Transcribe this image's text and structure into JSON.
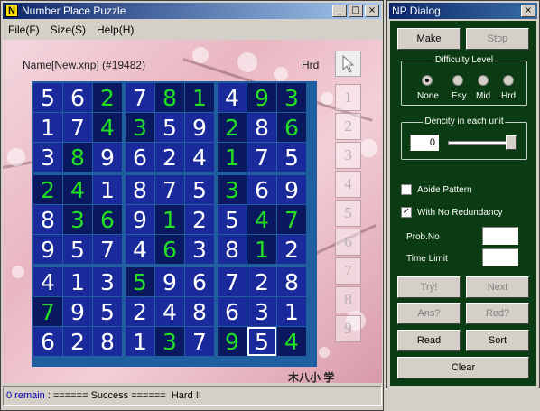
{
  "main_window": {
    "title": "Number Place Puzzle",
    "app_icon_letter": "N",
    "controls": {
      "min": "_",
      "max": "□",
      "close": "×"
    },
    "menu": [
      "File(F)",
      "Size(S)",
      "Help(H)"
    ],
    "puzzle_name": "Name[New.xnp] (#19482)",
    "difficulty": "Hrd",
    "credit": "木八小 学",
    "status": {
      "remain": "0 remain",
      "message": " : ====== Success ======  Hard !!"
    }
  },
  "grid": {
    "rows": [
      [
        "5",
        "6",
        "2",
        "7",
        "8",
        "1",
        "4",
        "9",
        "3"
      ],
      [
        "1",
        "7",
        "4",
        "3",
        "5",
        "9",
        "2",
        "8",
        "6"
      ],
      [
        "3",
        "8",
        "9",
        "6",
        "2",
        "4",
        "1",
        "7",
        "5"
      ],
      [
        "2",
        "4",
        "1",
        "8",
        "7",
        "5",
        "3",
        "6",
        "9"
      ],
      [
        "8",
        "3",
        "6",
        "9",
        "1",
        "2",
        "5",
        "4",
        "7"
      ],
      [
        "9",
        "5",
        "7",
        "4",
        "6",
        "3",
        "8",
        "1",
        "2"
      ],
      [
        "4",
        "1",
        "3",
        "5",
        "9",
        "6",
        "7",
        "2",
        "8"
      ],
      [
        "7",
        "9",
        "5",
        "2",
        "4",
        "8",
        "6",
        "3",
        "1"
      ],
      [
        "6",
        "2",
        "8",
        "1",
        "3",
        "7",
        "9",
        "5",
        "4"
      ]
    ],
    "solved_mask": [
      [
        0,
        0,
        1,
        0,
        1,
        1,
        0,
        1,
        1
      ],
      [
        0,
        0,
        1,
        1,
        0,
        0,
        1,
        0,
        1
      ],
      [
        0,
        1,
        0,
        0,
        0,
        0,
        1,
        0,
        0
      ],
      [
        1,
        1,
        0,
        0,
        0,
        0,
        1,
        0,
        0
      ],
      [
        0,
        1,
        1,
        0,
        1,
        0,
        0,
        1,
        1
      ],
      [
        0,
        0,
        0,
        0,
        1,
        0,
        0,
        1,
        0
      ],
      [
        0,
        0,
        0,
        1,
        0,
        0,
        0,
        0,
        0
      ],
      [
        1,
        0,
        0,
        0,
        0,
        0,
        0,
        0,
        0
      ],
      [
        0,
        0,
        0,
        0,
        1,
        0,
        1,
        0,
        1
      ]
    ],
    "selected": [
      8,
      7
    ],
    "colors": {
      "given_bg": "#1a2a9a",
      "solved_bg": "#0a1860",
      "solved_text": "#22e022",
      "given_text": "#ffffff",
      "border": "#1f5fa0"
    }
  },
  "number_buttons": [
    "1",
    "2",
    "3",
    "4",
    "5",
    "6",
    "7",
    "8",
    "9"
  ],
  "dialog": {
    "title": "NP Dialog",
    "close": "×",
    "make_label": "Make",
    "stop_label": "Stop",
    "difficulty_group": "Difficulty Level",
    "levels": [
      "None",
      "Esy",
      "Mid",
      "Hrd"
    ],
    "selected_level": "None",
    "density_group": "Dencity in each unit",
    "density_value": "0",
    "density_slider_fraction": 1.0,
    "abide_pattern_label": "Abide Pattern",
    "abide_pattern_checked": false,
    "no_redundancy_label": "With No Redundancy",
    "no_redundancy_checked": true,
    "prob_no_label": "Prob.No",
    "prob_no_value": "",
    "time_limit_label": "Time Limit",
    "time_limit_value": "",
    "try_label": "Try!",
    "next_label": "Next",
    "ans_label": "Ans?",
    "red_label": "Red?",
    "read_label": "Read",
    "sort_label": "Sort",
    "clear_label": "Clear"
  }
}
